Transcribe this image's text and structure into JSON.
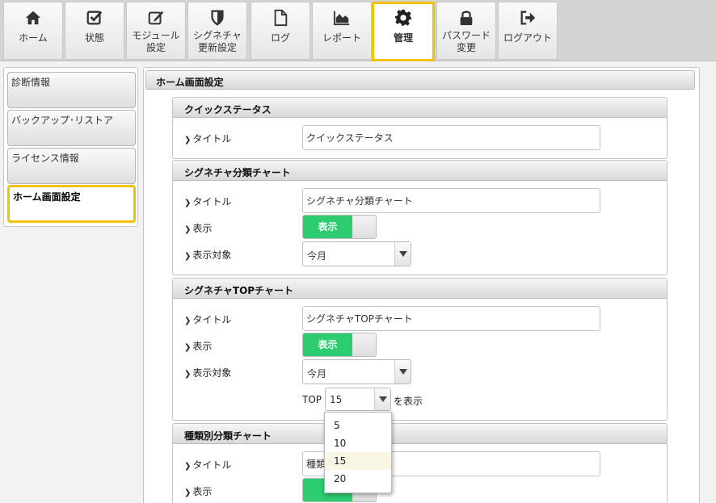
{
  "nav": {
    "tabs": [
      {
        "label": "ホーム",
        "icon": "home-icon"
      },
      {
        "label": "状態",
        "icon": "check-square-icon"
      },
      {
        "label": "モジュール\n設定",
        "icon": "edit-icon"
      },
      {
        "label": "シグネチャ\n更新設定",
        "icon": "shield-icon"
      },
      {
        "label": "ログ",
        "icon": "document-icon"
      },
      {
        "label": "レポート",
        "icon": "area-chart-icon"
      },
      {
        "label": "管理",
        "icon": "gear-icon"
      },
      {
        "label": "パスワード\n変更",
        "icon": "lock-icon"
      },
      {
        "label": "ログアウト",
        "icon": "sign-out-icon"
      }
    ],
    "active_tab": "管理",
    "highlight_color": "#f5c000"
  },
  "sidebar": {
    "items": [
      {
        "label": "診断情報"
      },
      {
        "label": "バックアップ･リストア"
      },
      {
        "label": "ライセンス情報"
      },
      {
        "label": "ホーム画面設定"
      }
    ],
    "active_item": "ホーム画面設定"
  },
  "main": {
    "title": "ホーム画面設定",
    "quick_status": {
      "heading": "クイックステータス",
      "title_label": "タイトル",
      "title_value": "クイックステータス"
    },
    "signature_category": {
      "heading": "シグネチャ分類チャート",
      "title_label": "タイトル",
      "title_value": "シグネチャ分類チャート",
      "display_label": "表示",
      "display_toggle": "表示",
      "target_label": "表示対象",
      "target_value": "今月"
    },
    "signature_top": {
      "heading": "シグネチャTOPチャート",
      "title_label": "タイトル",
      "title_value": "シグネチャTOPチャート",
      "display_label": "表示",
      "display_toggle": "表示",
      "target_label": "表示対象",
      "target_value": "今月",
      "top_prefix": "TOP",
      "top_value": "15",
      "top_suffix": "を表示",
      "top_options": [
        "5",
        "10",
        "15",
        "20"
      ]
    },
    "type_category": {
      "heading": "種類別分類チャート",
      "title_label": "タイトル",
      "title_value": "種類",
      "display_label": "表示"
    }
  },
  "colors": {
    "toggle_on": "#2ecc71",
    "highlight": "#f5c000"
  }
}
